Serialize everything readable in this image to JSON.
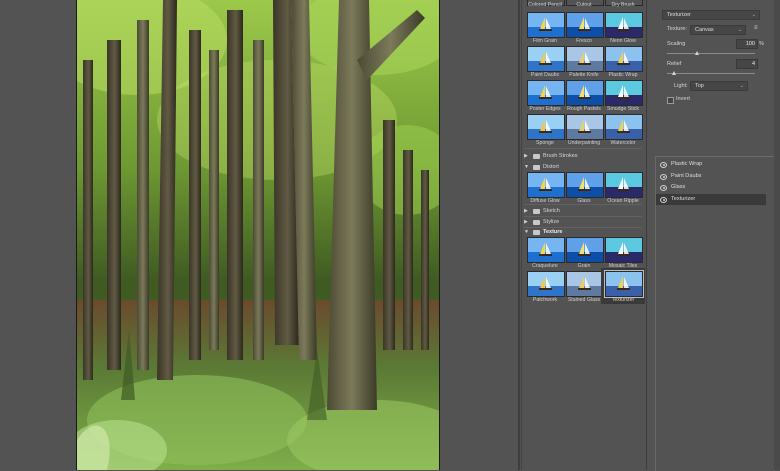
{
  "filter_gallery": {
    "artistic_partial_row": [
      "Colored Pencil",
      "Cutout",
      "Dry Brush"
    ],
    "artistic_rows": [
      [
        "Film Grain",
        "Fresco",
        "Neon Glow"
      ],
      [
        "Paint Daubs",
        "Palette Knife",
        "Plastic Wrap"
      ],
      [
        "Poster Edges",
        "Rough Pastels",
        "Smudge Stick"
      ],
      [
        "Sponge",
        "Underpainting",
        "Watercolor"
      ]
    ],
    "folders": {
      "brush_strokes": "Brush Strokes",
      "distort": "Distort",
      "sketch": "Sketch",
      "stylize": "Stylize",
      "texture": "Texture"
    },
    "distort_items": [
      "Diffuse Glow",
      "Glass",
      "Ocean Ripple"
    ],
    "texture_rows": [
      [
        "Craquelure",
        "Grain",
        "Mosaic Tiles"
      ],
      [
        "Patchwork",
        "Stained Glass",
        "Texturizer"
      ]
    ],
    "selected_filter": "Texturizer"
  },
  "settings": {
    "filter_select": "Texturizer",
    "texture_label": "Texture:",
    "texture_value": "Canvas",
    "scaling_label": "Scaling",
    "scaling_value": "100",
    "scaling_unit": "%",
    "scaling_level": 0.35,
    "relief_label": "Relief",
    "relief_value": "4",
    "relief_level": 0.08,
    "light_label": "Light:",
    "light_value": "Top",
    "invert_label": "Invert",
    "invert_checked": false
  },
  "layers": [
    {
      "name": "Plastic Wrap",
      "active": false
    },
    {
      "name": "Paint Daubs",
      "active": false
    },
    {
      "name": "Glass",
      "active": false
    },
    {
      "name": "Texturizer",
      "active": true
    }
  ]
}
